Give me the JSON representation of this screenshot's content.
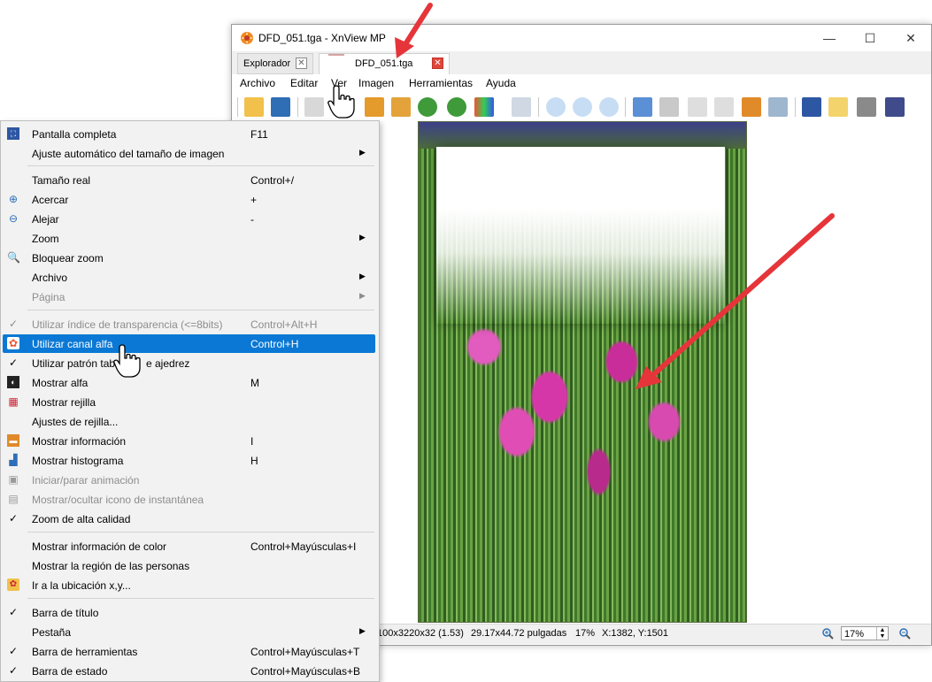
{
  "window": {
    "title": "DFD_051.tga - XnView MP",
    "minimize": "—",
    "maximize": "☐",
    "close": "✕"
  },
  "tabs": [
    {
      "label": "Explorador",
      "close": "✕"
    },
    {
      "label": "DFD_051.tga",
      "close": "✕"
    }
  ],
  "menubar": {
    "archivo": "Archivo",
    "editar": "Editar",
    "ver": "Ver",
    "imagen": "Imagen",
    "herramientas": "Herramientas",
    "ayuda": "Ayuda"
  },
  "dropdown": {
    "items": [
      {
        "label": "Pantalla completa",
        "shortcut": "F11"
      },
      {
        "label": "Ajuste automático del tamaño de imagen",
        "shortcut": "",
        "submenu": "▶"
      },
      {
        "label": "Tamaño real",
        "shortcut": "Control+/"
      },
      {
        "label": "Acercar",
        "shortcut": "+"
      },
      {
        "label": "Alejar",
        "shortcut": "-"
      },
      {
        "label": "Zoom",
        "shortcut": "",
        "submenu": "▶"
      },
      {
        "label": "Bloquear zoom",
        "shortcut": ""
      },
      {
        "label": "Archivo",
        "shortcut": "",
        "submenu": "▶"
      },
      {
        "label": "Página",
        "shortcut": "",
        "submenu": "▶"
      },
      {
        "label": "Utilizar índice de transparencia (<=8bits)",
        "shortcut": "Control+Alt+H"
      },
      {
        "label": "Utilizar canal alfa",
        "shortcut": "Control+H"
      },
      {
        "label": "Utilizar patrón tab",
        "label_tail": "e ajedrez",
        "shortcut": ""
      },
      {
        "label": "Mostrar alfa",
        "shortcut": "M"
      },
      {
        "label": "Mostrar rejilla",
        "shortcut": ""
      },
      {
        "label": "Ajustes de rejilla...",
        "shortcut": ""
      },
      {
        "label": "Mostrar información",
        "shortcut": "I"
      },
      {
        "label": "Mostrar histograma",
        "shortcut": "H"
      },
      {
        "label": "Iniciar/parar animación",
        "shortcut": ""
      },
      {
        "label": "Mostrar/ocultar icono de instantánea",
        "shortcut": ""
      },
      {
        "label": "Zoom de alta calidad",
        "shortcut": ""
      },
      {
        "label": "Mostrar información de color",
        "shortcut": "Control+Mayúsculas+I"
      },
      {
        "label": "Mostrar la región de las personas",
        "shortcut": ""
      },
      {
        "label": "Ir a la ubicación x,y...",
        "shortcut": ""
      },
      {
        "label": "Barra de título",
        "shortcut": ""
      },
      {
        "label": "Pestaña",
        "shortcut": "",
        "submenu": "▶"
      },
      {
        "label": "Barra de herramientas",
        "shortcut": "Control+Mayúsculas+T"
      },
      {
        "label": "Barra de estado",
        "shortcut": "Control+Mayúsculas+B"
      }
    ],
    "check": "✓"
  },
  "status": {
    "dimensions": "100x3220x32 (1.53)",
    "size_inches": "29.17x44.72 pulgadas",
    "zoom_percent": "17%",
    "coords": "X:1382, Y:1501",
    "zoom_value": "17%"
  },
  "colors": {
    "highlight": "#0a78d4",
    "arrow": "#e5353a"
  }
}
